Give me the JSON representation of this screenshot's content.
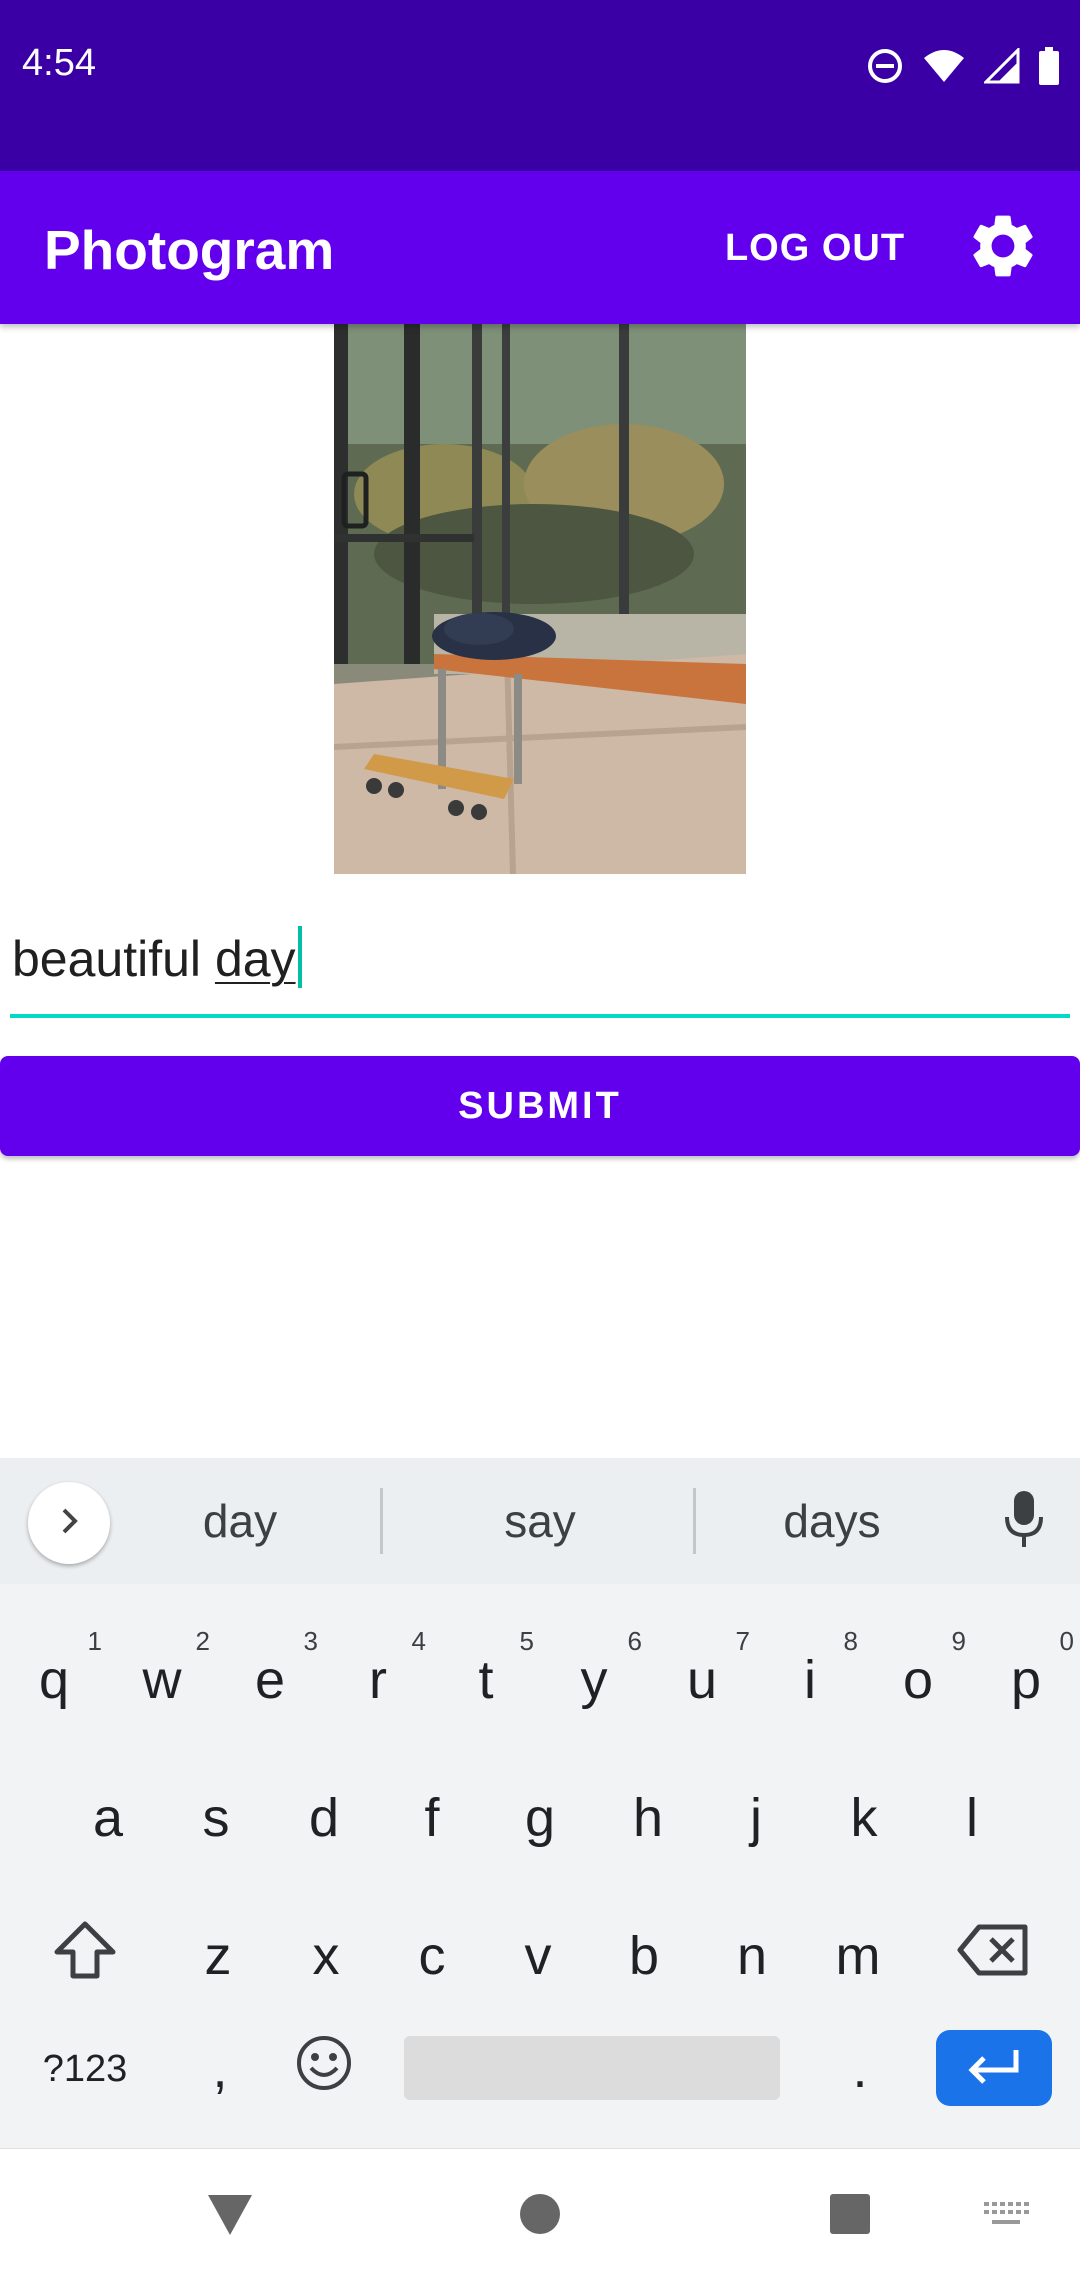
{
  "status_bar": {
    "time": "4:54",
    "icons": [
      "do-not-disturb-icon",
      "wifi-icon",
      "cell-signal-icon",
      "battery-icon"
    ]
  },
  "app_bar": {
    "title": "Photogram",
    "logout_label": "LOG OUT",
    "settings_icon": "gear-icon"
  },
  "post": {
    "caption_committed": "beautiful ",
    "caption_composing": "day",
    "submit_label": "SUBMIT"
  },
  "keyboard": {
    "suggestions": [
      "day",
      "say",
      "days"
    ],
    "row1": [
      {
        "key": "q",
        "hint": "1"
      },
      {
        "key": "w",
        "hint": "2"
      },
      {
        "key": "e",
        "hint": "3"
      },
      {
        "key": "r",
        "hint": "4"
      },
      {
        "key": "t",
        "hint": "5"
      },
      {
        "key": "y",
        "hint": "6"
      },
      {
        "key": "u",
        "hint": "7"
      },
      {
        "key": "i",
        "hint": "8"
      },
      {
        "key": "o",
        "hint": "9"
      },
      {
        "key": "p",
        "hint": "0"
      }
    ],
    "row2": [
      "a",
      "s",
      "d",
      "f",
      "g",
      "h",
      "j",
      "k",
      "l"
    ],
    "row3": [
      "z",
      "x",
      "c",
      "v",
      "b",
      "n",
      "m"
    ],
    "symbols_label": "?123",
    "comma": ",",
    "period": "."
  },
  "colors": {
    "status_bar": "#3a00a5",
    "primary": "#6200ee",
    "accent": "#03dac5",
    "enter_key": "#1a73e8"
  }
}
